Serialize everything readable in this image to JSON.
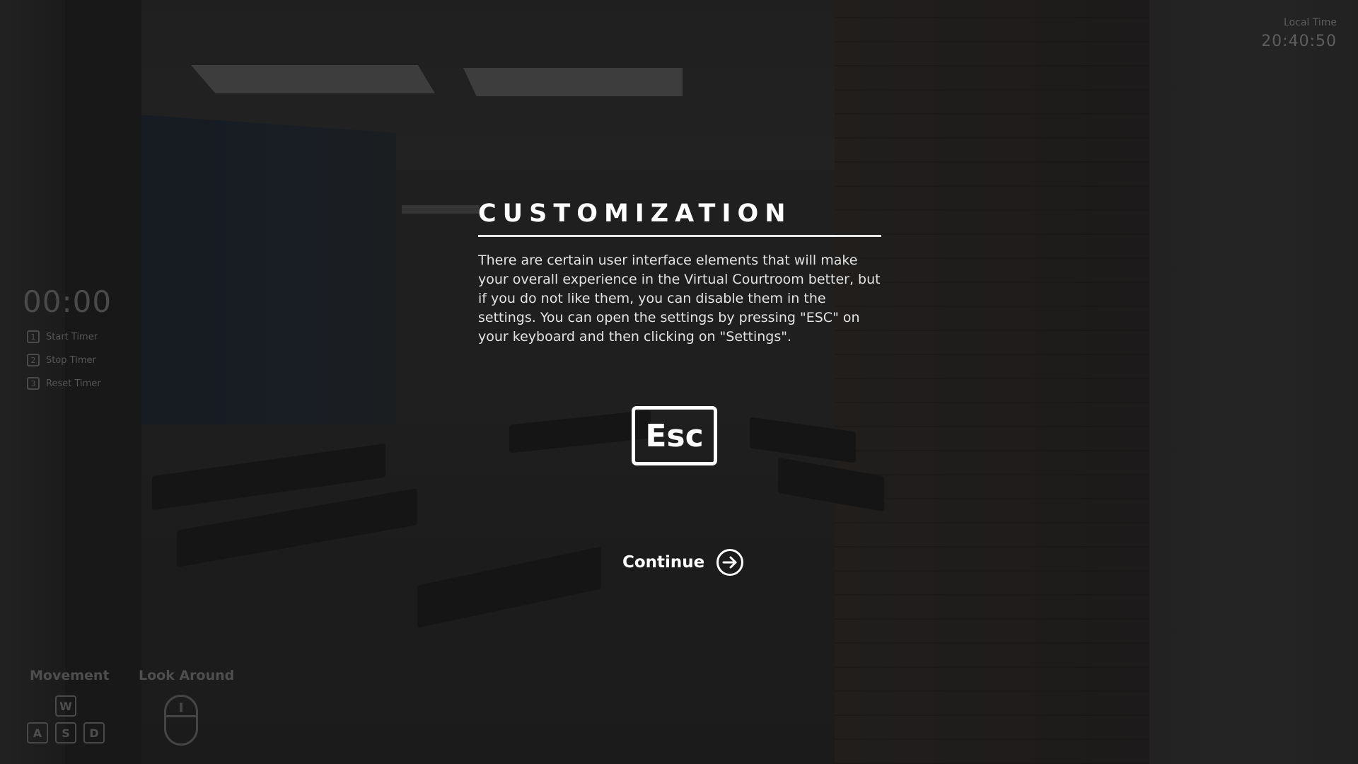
{
  "hud": {
    "local_time_label": "Local Time",
    "local_time_value": "20:40:50",
    "timer_value": "00:00",
    "timer_controls": [
      {
        "key": "1",
        "label": "Start Timer"
      },
      {
        "key": "2",
        "label": "Stop Timer"
      },
      {
        "key": "3",
        "label": "Reset Timer"
      }
    ],
    "movement_label": "Movement",
    "movement_keys": {
      "up": "W",
      "left": "A",
      "down": "S",
      "right": "D"
    },
    "look_label": "Look Around",
    "look_icon": "mouse-icon"
  },
  "dialog": {
    "title": "CUSTOMIZATION",
    "body": "There are certain user interface elements that will make your overall experience in the Virtual Courtroom better, but if you do not like them, you can disable them in the settings. You can open the settings by pressing \"ESC\" on your keyboard and then clicking on \"Settings\".",
    "key_label": "Esc",
    "continue_label": "Continue",
    "continue_icon": "arrow-right-circle-icon"
  },
  "colors": {
    "text_primary": "#ffffff",
    "text_body": "#e3e3e3",
    "hud_faded": "#555555"
  }
}
